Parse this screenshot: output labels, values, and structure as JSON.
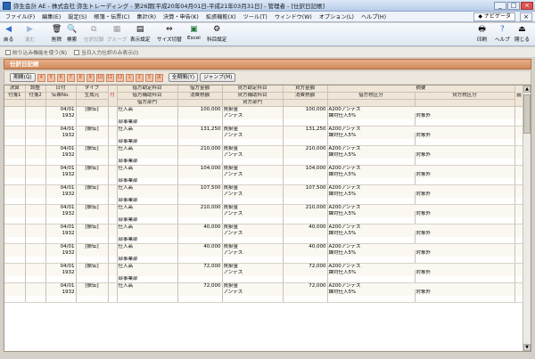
{
  "window": {
    "title": "弥生会計 AE - 株式会社 弥生トレーディング - 第26期[平成20年04月01日-平成21年03月31日] - 管理者 - [仕訳日記帳]",
    "navi_label": "ナビゲータ",
    "navi_close": "×"
  },
  "menu": [
    "ファイル(F)",
    "編集(E)",
    "設定(S)",
    "帳簿・伝票(C)",
    "集計(R)",
    "決算・申告(K)",
    "拡張機能(X)",
    "ツール(T)",
    "ウィンドウ(W)",
    "オプション(L)",
    "ヘルプ(H)"
  ],
  "toolbar": {
    "back": "戻る",
    "forward": "進む",
    "delete": "削除",
    "search": "検索",
    "copy": "仕訳記録",
    "group": "グループ",
    "display": "表示設定",
    "resize": "サイズ切替",
    "excel": "Excel",
    "subject": "科目設定",
    "print": "印刷",
    "help": "ヘルプ",
    "close": "閉じる"
  },
  "filters": {
    "f1": "絞り込み機能を使う(N)",
    "f2": "当日入力仕訳のみ表示(I)"
  },
  "section_title": "仕訳日記帳",
  "controls": {
    "period": "期間(Q)",
    "months": [
      "4",
      "5",
      "6",
      "7",
      "8",
      "9",
      "10",
      "11",
      "12",
      "1",
      "2",
      "3",
      "決"
    ],
    "all_period": "全期間(Y)",
    "jump": "ジャンプ(M)"
  },
  "headers": {
    "r1": [
      "決算",
      "調整",
      "日付",
      "タイプ",
      "借方勘定科目",
      "借方金額",
      "貸方勘定科目",
      "貸方金額",
      "摘要"
    ],
    "r2": [
      "付箋1",
      "付箋2",
      "伝票No.",
      "生成元",
      "借方補助科目",
      "消費税額",
      "貸方補助科目",
      "消費税額",
      "借方税区分",
      "貸方税区分"
    ],
    "r3": [
      "借方部門",
      "貸方部門"
    ],
    "flag": "付"
  },
  "entries": [
    {
      "date": "04/01",
      "type": "[振伝]",
      "no": "1932",
      "debit": "仕入高",
      "debit_amt": "100,000",
      "credit": "買掛金",
      "credit_amt": "100,000",
      "credit_sub": "アンデス",
      "memo": "A200アンデス",
      "debit_tax": "課対仕入5%",
      "credit_tax": "対象外",
      "dept": "部事業部"
    },
    {
      "date": "04/01",
      "type": "[振伝]",
      "no": "1932",
      "debit": "仕入高",
      "debit_amt": "131,250",
      "credit": "買掛金",
      "credit_amt": "131,250",
      "credit_sub": "アンデス",
      "memo": "A200アンデス",
      "debit_tax": "課対仕入5%",
      "credit_tax": "対象外",
      "dept": "部事業部"
    },
    {
      "date": "04/01",
      "type": "[振伝]",
      "no": "1932",
      "debit": "仕入高",
      "debit_amt": "210,000",
      "credit": "買掛金",
      "credit_amt": "210,000",
      "credit_sub": "アンデス",
      "memo": "A200アンデス",
      "debit_tax": "課対仕入5%",
      "credit_tax": "対象外",
      "dept": "部事業部"
    },
    {
      "date": "04/01",
      "type": "[振伝]",
      "no": "1932",
      "debit": "仕入高",
      "debit_amt": "104,000",
      "credit": "買掛金",
      "credit_amt": "104,000",
      "credit_sub": "アンデス",
      "memo": "A200アンデス",
      "debit_tax": "課対仕入5%",
      "credit_tax": "対象外",
      "dept": "部事業部"
    },
    {
      "date": "04/01",
      "type": "[振伝]",
      "no": "1932",
      "debit": "仕入高",
      "debit_amt": "107,500",
      "credit": "買掛金",
      "credit_amt": "107,500",
      "credit_sub": "アンデス",
      "memo": "A200アンデス",
      "debit_tax": "課対仕入5%",
      "credit_tax": "対象外",
      "dept": "部事業部"
    },
    {
      "date": "04/01",
      "type": "[振伝]",
      "no": "1932",
      "debit": "仕入高",
      "debit_amt": "210,000",
      "credit": "買掛金",
      "credit_amt": "210,000",
      "credit_sub": "アンデス",
      "memo": "A200アンデス",
      "debit_tax": "課対仕入5%",
      "credit_tax": "対象外",
      "dept": "部事業部"
    },
    {
      "date": "04/01",
      "type": "[振伝]",
      "no": "1932",
      "debit": "仕入高",
      "debit_amt": "40,000",
      "credit": "買掛金",
      "credit_amt": "40,000",
      "credit_sub": "アンデス",
      "memo": "A200アンデス",
      "debit_tax": "課対仕入5%",
      "credit_tax": "対象外",
      "dept": "部事業部"
    },
    {
      "date": "04/01",
      "type": "[振伝]",
      "no": "1932",
      "debit": "仕入高",
      "debit_amt": "40,000",
      "credit": "買掛金",
      "credit_amt": "40,000",
      "credit_sub": "アンデス",
      "memo": "A200アンデス",
      "debit_tax": "課対仕入5%",
      "credit_tax": "対象外",
      "dept": "部事業部"
    },
    {
      "date": "04/01",
      "type": "[振伝]",
      "no": "1932",
      "debit": "仕入高",
      "debit_amt": "72,000",
      "credit": "買掛金",
      "credit_amt": "72,000",
      "credit_sub": "アンデス",
      "memo": "A200アンデス",
      "debit_tax": "課対仕入5%",
      "credit_tax": "対象外",
      "dept": "部事業部"
    },
    {
      "date": "04/01",
      "type": "[振伝]",
      "no": "1932",
      "debit": "仕入高",
      "debit_amt": "72,000",
      "credit": "買掛金",
      "credit_amt": "72,000",
      "credit_sub": "アンデス",
      "memo": "A200アンデス",
      "debit_tax": "課対仕入5%",
      "credit_tax": "対象外",
      "dept": ""
    }
  ]
}
